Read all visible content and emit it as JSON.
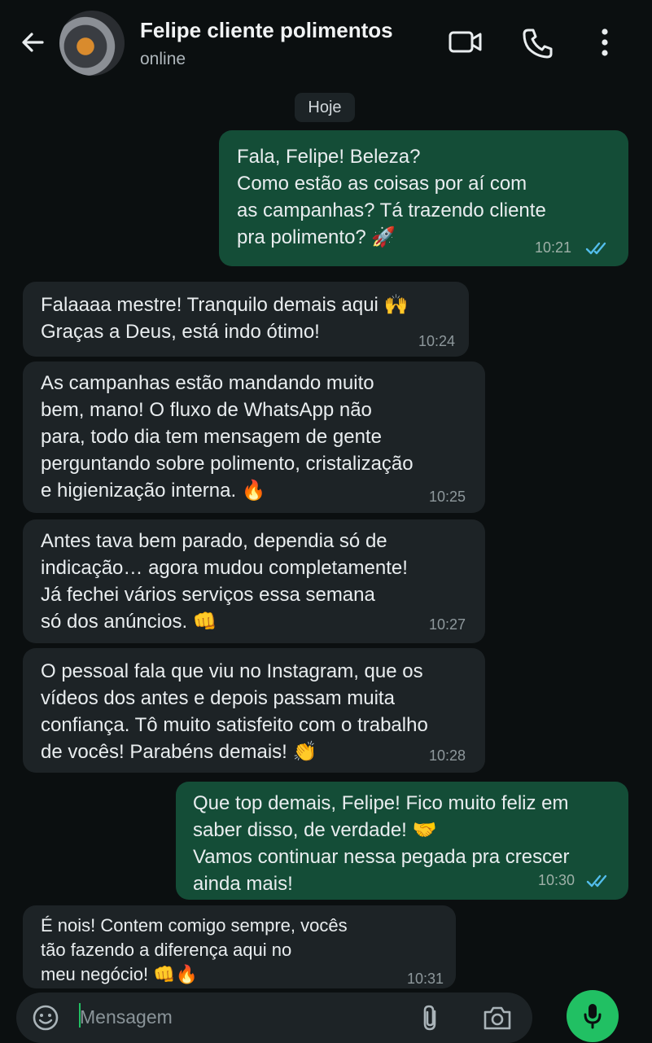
{
  "header": {
    "contact_name": "Felipe cliente polimentos",
    "status": "online"
  },
  "chat": {
    "date_label": "Hoje",
    "messages": [
      {
        "direction": "out",
        "text": "Fala, Felipe! Beleza?\nComo estão as coisas por aí com\nas campanhas? Tá trazendo cliente\npra polimento? 🚀",
        "time": "10:21",
        "read": true
      },
      {
        "direction": "in",
        "text": "Falaaaa mestre! Tranquilo demais aqui 🙌\nGraças a Deus, está indo ótimo!",
        "time": "10:24"
      },
      {
        "direction": "in",
        "text": "As campanhas estão mandando muito\nbem, mano! O fluxo de WhatsApp não\npara, todo dia tem mensagem de gente\nperguntando sobre polimento, cristalização\ne higienização interna. 🔥",
        "time": "10:25"
      },
      {
        "direction": "in",
        "text": "Antes tava bem parado, dependia só de\nindicação… agora mudou completamente!\nJá fechei vários serviços essa semana\nsó dos anúncios. 👊",
        "time": "10:27"
      },
      {
        "direction": "in",
        "text": "O pessoal fala que viu no Instagram, que os\nvídeos dos antes e depois passam muita\nconfiança. Tô muito satisfeito com o trabalho\nde vocês! Parabéns demais! 👏",
        "time": "10:28"
      },
      {
        "direction": "out",
        "text": "Que top demais, Felipe! Fico muito feliz em\nsaber disso, de verdade! 🤝\nVamos continuar nessa pegada pra crescer\nainda mais!",
        "time": "10:30",
        "read": true
      },
      {
        "direction": "in",
        "text": "É nois! Contem comigo sempre, vocês\ntão fazendo a diferença aqui no\nmeu negócio! 👊🔥",
        "time": "10:31"
      }
    ]
  },
  "composer": {
    "placeholder": "Mensagem"
  },
  "icons": {
    "back": "arrow-left-icon",
    "video": "video-call-icon",
    "phone": "phone-icon",
    "menu": "more-vertical-icon",
    "emoji": "emoji-icon",
    "attach": "paperclip-icon",
    "camera": "camera-icon",
    "mic": "microphone-icon"
  },
  "colors": {
    "outgoing_bubble": "#144d37",
    "incoming_bubble": "#1d2326",
    "accent": "#21c063",
    "read_ticks": "#53bdeb"
  }
}
